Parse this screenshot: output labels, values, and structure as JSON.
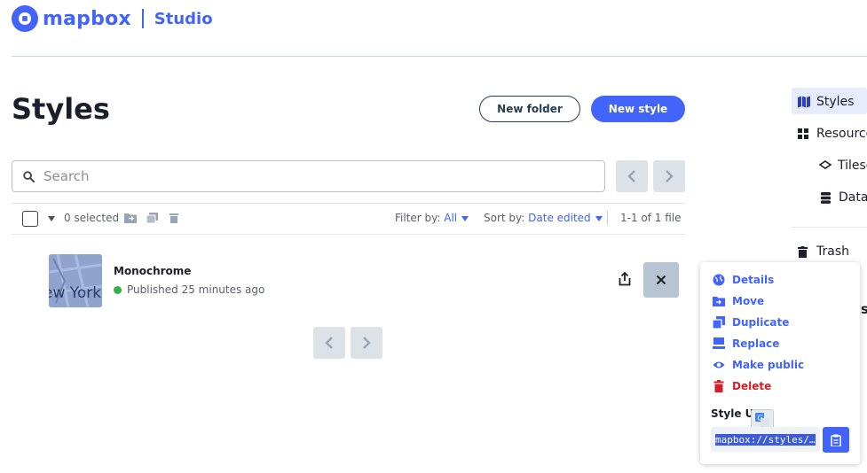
{
  "header": {
    "brand": "mapbox",
    "product": "Studio"
  },
  "page": {
    "title": "Styles",
    "new_folder_label": "New folder",
    "new_style_label": "New style"
  },
  "search": {
    "placeholder": "Search"
  },
  "toolbar": {
    "selected_text": "0 selected",
    "filter_label": "Filter by:",
    "filter_value": "All",
    "sort_label": "Sort by:",
    "sort_value": "Date edited",
    "pagination": "1-1 of 1 file"
  },
  "styles": [
    {
      "name": "Monochrome",
      "status": "Published 25 minutes ago",
      "thumbnail_text": "ew York"
    }
  ],
  "sidebar": {
    "items": [
      {
        "label": "Styles",
        "icon": "map-icon"
      },
      {
        "label": "Resources",
        "icon": "grid-icon"
      },
      {
        "label": "Tilesets",
        "icon": "layers-icon"
      },
      {
        "label": "Datasets",
        "icon": "database-icon"
      },
      {
        "label": "Trash",
        "icon": "trash-icon"
      }
    ]
  },
  "menu": {
    "items": [
      {
        "label": "Details",
        "icon": "globe-icon"
      },
      {
        "label": "Move",
        "icon": "move-folder-icon"
      },
      {
        "label": "Duplicate",
        "icon": "duplicate-icon"
      },
      {
        "label": "Replace",
        "icon": "replace-icon"
      },
      {
        "label": "Make public",
        "icon": "eye-icon"
      },
      {
        "label": "Delete",
        "icon": "trash-icon"
      }
    ],
    "style_url_label": "Style URL",
    "style_url_value": "mapbox://styles/…"
  },
  "colors": {
    "brand_blue": "#4264fb",
    "danger_red": "#d0202a",
    "published_green": "#33b04a"
  }
}
